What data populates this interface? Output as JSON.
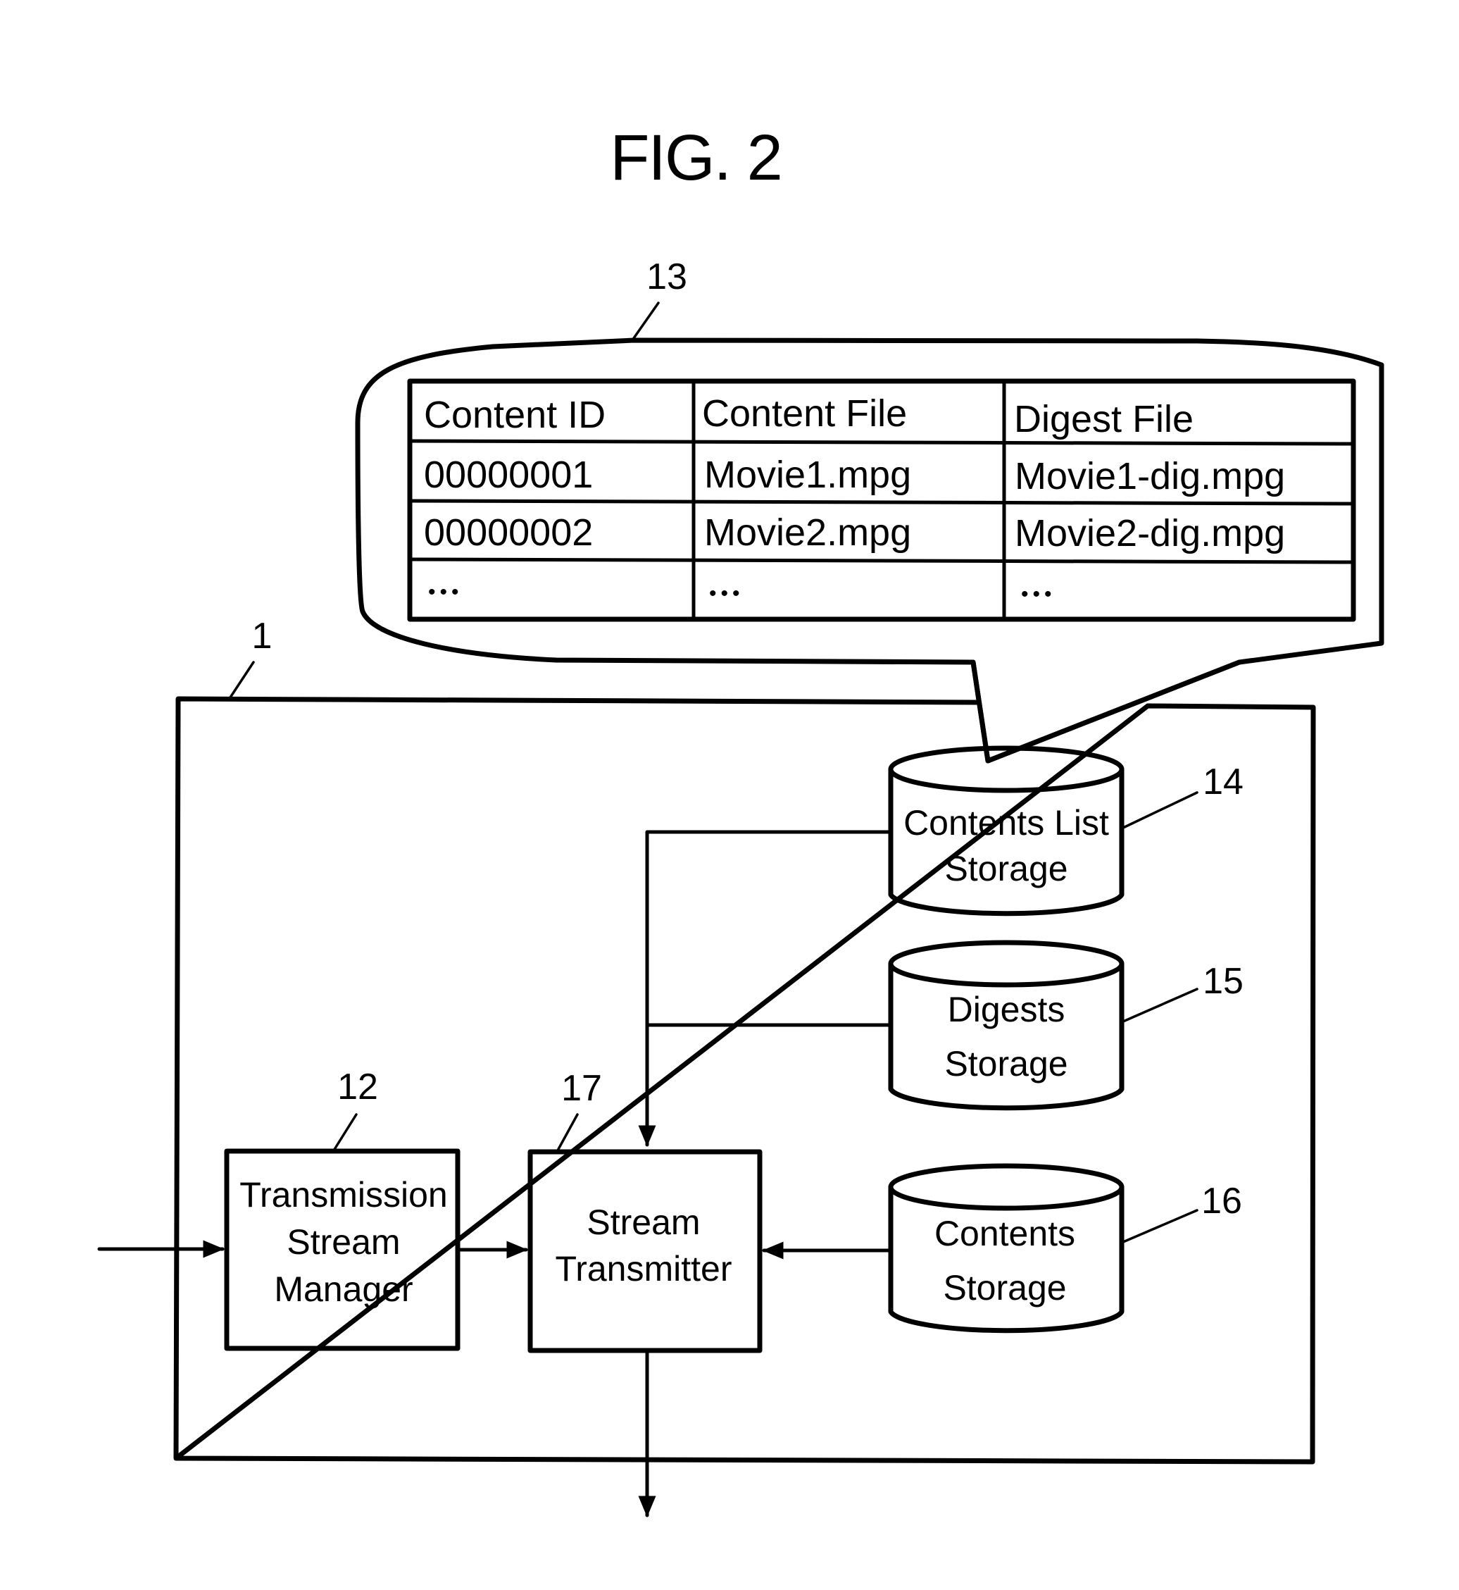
{
  "figure": {
    "title": "FIG. 2"
  },
  "colors": {
    "ink": "#000000",
    "paper": "#ffffff"
  },
  "refs": {
    "device": "1",
    "stream_manager": "12",
    "contents_list_callout": "13",
    "contents_list_storage": "14",
    "digests_storage": "15",
    "contents_storage": "16",
    "stream_transmitter": "17"
  },
  "contents_table": {
    "columns": [
      "Content ID",
      "Content File",
      "Digest File"
    ],
    "rows": [
      [
        "00000001",
        "Movie1.mpg",
        "Movie1-dig.mpg"
      ],
      [
        "00000002",
        "Movie2.mpg",
        "Movie2-dig.mpg"
      ],
      [
        "•••",
        "•••",
        "•••"
      ]
    ]
  },
  "blocks": {
    "stream_manager": [
      "Transmission",
      "Stream",
      "Manager"
    ],
    "stream_transmitter": [
      "Stream",
      "Transmitter"
    ]
  },
  "storages": {
    "contents_list": [
      "Contents List",
      "Storage"
    ],
    "digests": [
      "Digests",
      "Storage"
    ],
    "contents": [
      "Contents",
      "Storage"
    ]
  }
}
